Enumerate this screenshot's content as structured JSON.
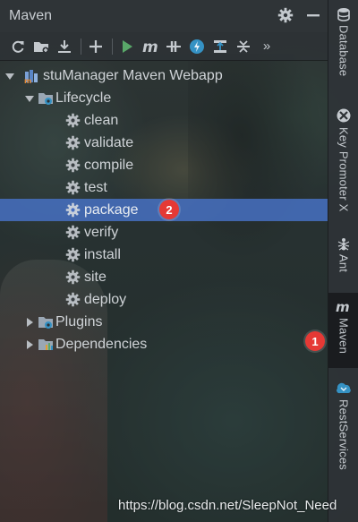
{
  "panel": {
    "title": "Maven",
    "title_actions": [
      "gear-icon",
      "minimize-icon"
    ],
    "toolbar": [
      {
        "name": "reload-icon",
        "tooltip": ""
      },
      {
        "name": "add-folder-icon",
        "tooltip": ""
      },
      {
        "name": "download-icon",
        "tooltip": ""
      },
      {
        "name": "plus-icon",
        "tooltip": ""
      },
      {
        "name": "run-icon",
        "tooltip": ""
      },
      {
        "name": "maven-m-icon",
        "tooltip": ""
      },
      {
        "name": "toggle-offline-icon",
        "tooltip": ""
      },
      {
        "name": "skip-tests-icon",
        "tooltip": ""
      },
      {
        "name": "show-dependencies-icon",
        "tooltip": ""
      },
      {
        "name": "collapse-all-icon",
        "tooltip": ""
      },
      {
        "name": "more-icon",
        "tooltip": ""
      }
    ],
    "more_glyph": "»"
  },
  "tree": {
    "project": "stuManager Maven Webapp",
    "lifecycle": {
      "label": "Lifecycle",
      "goals": [
        "clean",
        "validate",
        "compile",
        "test",
        "package",
        "verify",
        "install",
        "site",
        "deploy"
      ],
      "selected": "package"
    },
    "plugins": "Plugins",
    "dependencies": "Dependencies"
  },
  "annotations": {
    "badge_1": "1",
    "badge_2": "2"
  },
  "side_strip": [
    {
      "label": "Database",
      "icon": "database-icon"
    },
    {
      "label": "Key Promoter X",
      "icon": "key-promoter-icon"
    },
    {
      "label": "Ant",
      "icon": "ant-icon"
    },
    {
      "label": "Maven",
      "icon": "maven-icon",
      "active": true
    },
    {
      "label": "RestServices",
      "icon": "rest-services-icon"
    }
  ],
  "watermark": "https://blog.csdn.net/SleepNot_Need",
  "colors": {
    "selection": "#466ebe",
    "badge": "#e53935",
    "run_green": "#59a869",
    "accent_blue": "#3592c4"
  }
}
